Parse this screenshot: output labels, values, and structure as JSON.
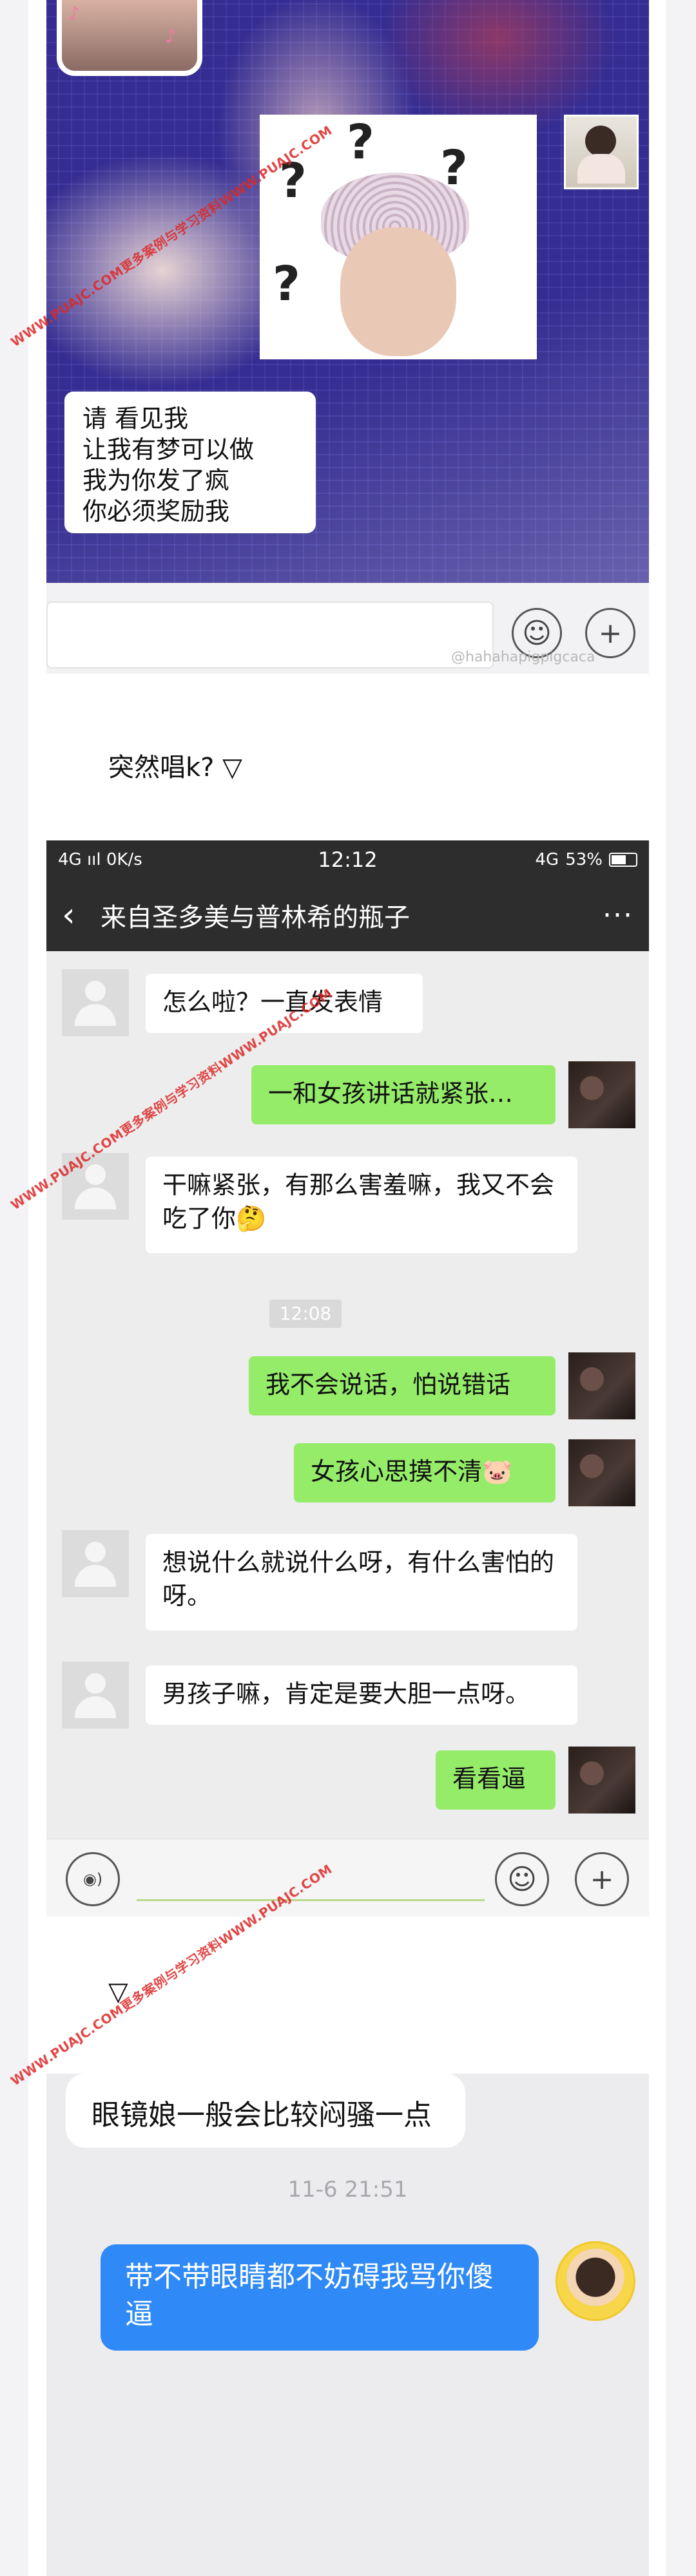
{
  "section1": {
    "lyric_lines": [
      "请 看见我",
      "让我有梦可以做",
      "我为你发了疯",
      "你必须奖励我"
    ],
    "meme_marks": [
      "?",
      "?",
      "?",
      "?"
    ],
    "weibo_watermark": "@hahahapigpigcaca"
  },
  "caption1": "突然唱k?  ▽",
  "wechat": {
    "status": {
      "left": "4G ııl  0K/s",
      "time": "12:12",
      "network": "4G",
      "battery": "53%"
    },
    "title": "来自圣多美与普林希的瓶子",
    "more": "···",
    "messages": [
      {
        "side": "in",
        "text": "怎么啦？一直发表情"
      },
      {
        "side": "out",
        "text": "一和女孩讲话就紧张…"
      },
      {
        "side": "in",
        "text": "干嘛紧张，有那么害羞嘛，我又不会吃了你🤔"
      },
      {
        "side": "out",
        "text": "我不会说话，怕说错话"
      },
      {
        "side": "out",
        "text": "女孩心思摸不清🐷"
      },
      {
        "side": "in",
        "text": "想说什么就说什么呀，有什么害怕的呀。"
      },
      {
        "side": "in",
        "text": "男孩子嘛，肯定是要大胆一点呀。"
      },
      {
        "side": "out",
        "text": "看看逼"
      }
    ],
    "timestamp": "12:08"
  },
  "caption2": "▽",
  "qq": {
    "incoming": "眼镜娘一般会比较闷骚一点",
    "time": "11-6 21:51",
    "outgoing": "带不带眼睛都不妨碍我骂你傻逼"
  },
  "watermarks": [
    "WWW.PUAJC.COM更多案例与学习资料WWW.PUAJC.COM",
    "WWW.PUAJC.COM更多案例与学习资料WWW.PUAJC.COM",
    "WWW.PUAJC.COM更多案例与学习资料WWW.PUAJC.COM"
  ],
  "icons": {
    "emoji": "☺",
    "plus": "+",
    "voice": "◉)",
    "back": "‹"
  }
}
